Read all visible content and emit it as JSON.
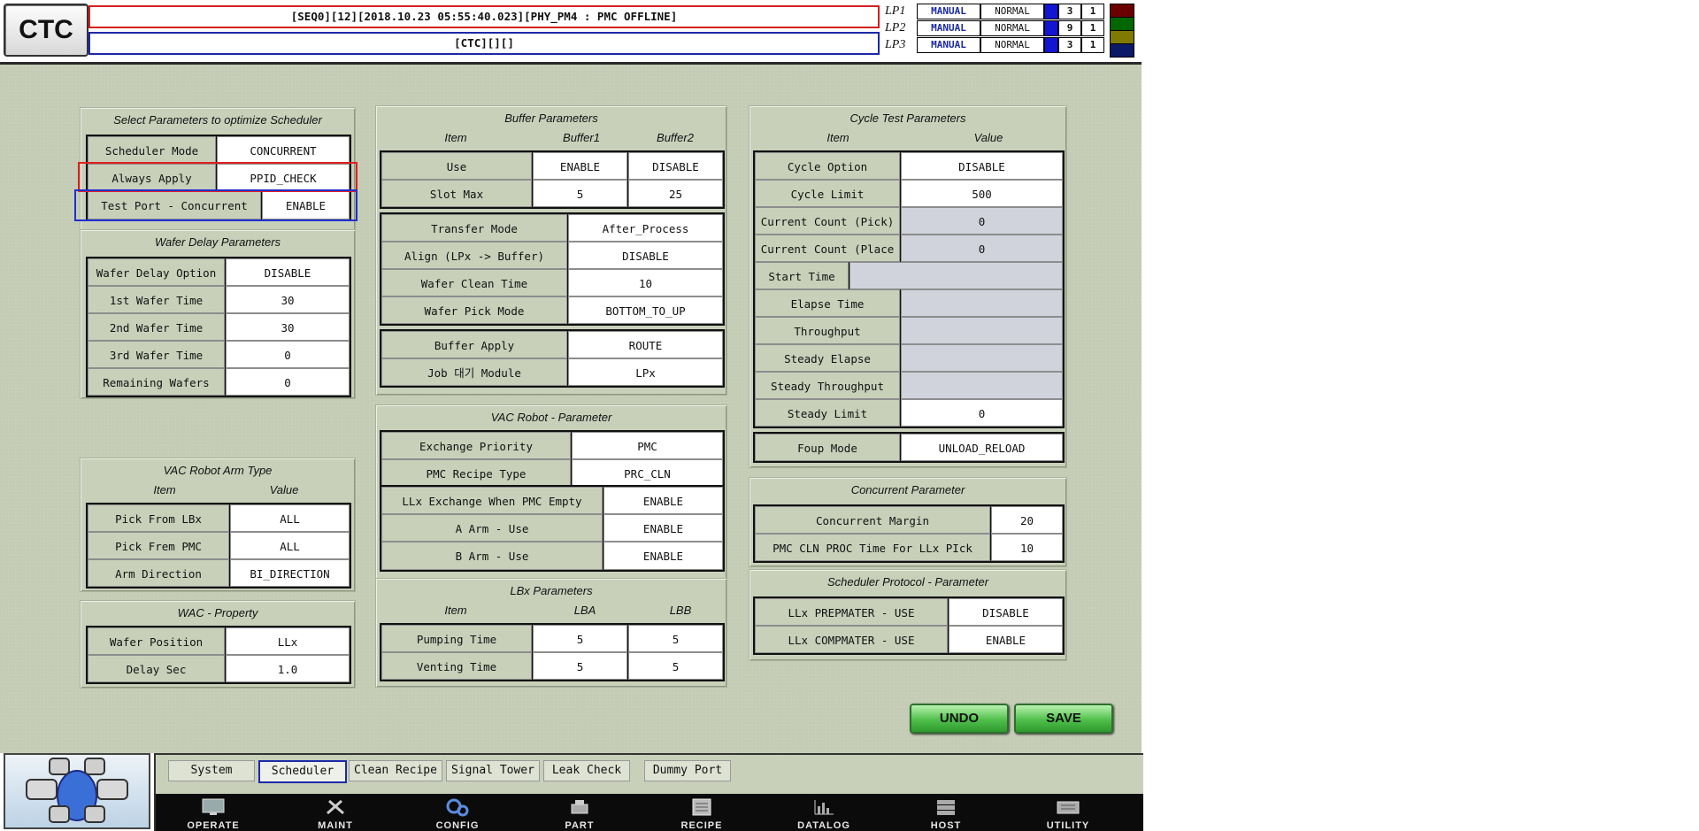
{
  "header": {
    "logo": "CTC",
    "message_top": "[SEQ0][12][2018.10.23 05:55:40.023][PHY_PM4 : PMC OFFLINE]",
    "message_bottom": "[CTC][][]",
    "load_ports": [
      {
        "name": "LP1",
        "mode": "MANUAL",
        "state": "NORMAL",
        "n1": "3",
        "n2": "1",
        "swatch": "#6b0000"
      },
      {
        "name": "LP2",
        "mode": "MANUAL",
        "state": "NORMAL",
        "n1": "9",
        "n2": "1",
        "swatch": "#006600"
      },
      {
        "name": "LP3",
        "mode": "MANUAL",
        "state": "NORMAL",
        "n1": "3",
        "n2": "1",
        "swatch": "#7f7a00"
      }
    ],
    "extra_swatch": "#0a1a66"
  },
  "scheduler": {
    "title": "Select Parameters to optimize Scheduler",
    "rows": [
      {
        "label": "Scheduler Mode",
        "value": "CONCURRENT"
      },
      {
        "label": "Always Apply",
        "value": "PPID_CHECK"
      },
      {
        "label": "Test Port - Concurrent",
        "value": "ENABLE"
      }
    ]
  },
  "wafer_delay": {
    "title": "Wafer Delay Parameters",
    "rows": [
      {
        "label": "Wafer Delay Option",
        "value": "DISABLE"
      },
      {
        "label": "1st Wafer Time",
        "value": "30"
      },
      {
        "label": "2nd Wafer Time",
        "value": "30"
      },
      {
        "label": "3rd Wafer Time",
        "value": "0"
      },
      {
        "label": "Remaining Wafers",
        "value": "0"
      }
    ]
  },
  "vac_arm": {
    "title": "VAC Robot Arm Type",
    "col1": "Item",
    "col2": "Value",
    "rows": [
      {
        "label": "Pick From LBx",
        "value": "ALL"
      },
      {
        "label": "Pick Frem PMC",
        "value": "ALL"
      },
      {
        "label": "Arm Direction",
        "value": "BI_DIRECTION"
      }
    ]
  },
  "wac": {
    "title": "WAC - Property",
    "rows": [
      {
        "label": "Wafer Position",
        "value": "LLx"
      },
      {
        "label": "Delay Sec",
        "value": "1.0"
      }
    ]
  },
  "buffer": {
    "title": "Buffer Parameters",
    "col1": "Item",
    "col2": "Buffer1",
    "col3": "Buffer2",
    "rows": [
      {
        "label": "Use",
        "v1": "ENABLE",
        "v2": "DISABLE"
      },
      {
        "label": "Slot Max",
        "v1": "5",
        "v2": "25"
      }
    ],
    "rows2": [
      {
        "label": "Transfer Mode",
        "value": "After_Process"
      },
      {
        "label": "Align (LPx -> Buffer)",
        "value": "DISABLE"
      },
      {
        "label": "Wafer Clean Time",
        "value": "10"
      },
      {
        "label": "Wafer Pick Mode",
        "value": "BOTTOM_TO_UP"
      }
    ],
    "rows3": [
      {
        "label": "Buffer Apply",
        "value": "ROUTE"
      },
      {
        "label": "Job 대기 Module",
        "value": "LPx"
      }
    ]
  },
  "vac_robot": {
    "title": "VAC Robot - Parameter",
    "rows": [
      {
        "label": "Exchange Priority",
        "value": "PMC"
      },
      {
        "label": "PMC Recipe Type",
        "value": "PRC_CLN"
      }
    ],
    "rows2": [
      {
        "label": "LLx Exchange When PMC Empty",
        "value": "ENABLE"
      },
      {
        "label": "A Arm - Use",
        "value": "ENABLE"
      },
      {
        "label": "B Arm - Use",
        "value": "ENABLE"
      }
    ]
  },
  "lbx": {
    "title": "LBx Parameters",
    "col1": "Item",
    "col2": "LBA",
    "col3": "LBB",
    "rows": [
      {
        "label": "Pumping Time",
        "v1": "5",
        "v2": "5"
      },
      {
        "label": "Venting Time",
        "v1": "5",
        "v2": "5"
      }
    ]
  },
  "cycle": {
    "title": "Cycle Test Parameters",
    "col1": "Item",
    "col2": "Value",
    "rows": [
      {
        "label": "Cycle Option",
        "value": "DISABLE"
      },
      {
        "label": "Cycle Limit",
        "value": "500"
      },
      {
        "label": "Current Count (Pick)",
        "value": "0"
      },
      {
        "label": "Current Count (Place",
        "value": "0"
      },
      {
        "label": "Start Time",
        "value": ""
      },
      {
        "label": "Elapse Time",
        "value": ""
      },
      {
        "label": "Throughput",
        "value": ""
      },
      {
        "label": "Steady Elapse",
        "value": ""
      },
      {
        "label": "Steady Throughput",
        "value": ""
      },
      {
        "label": "Steady Limit",
        "value": "0"
      }
    ],
    "foup_label": "Foup Mode",
    "foup_value": "UNLOAD_RELOAD"
  },
  "concurrent": {
    "title": "Concurrent Parameter",
    "rows": [
      {
        "label": "Concurrent Margin",
        "value": "20"
      },
      {
        "label": "PMC CLN PROC Time For LLx PIck",
        "value": "10"
      }
    ]
  },
  "protocol": {
    "title": "Scheduler Protocol - Parameter",
    "rows": [
      {
        "label": "LLx PREPMATER - USE",
        "value": "DISABLE"
      },
      {
        "label": "LLx COMPMATER - USE",
        "value": "ENABLE"
      }
    ]
  },
  "actions": {
    "undo": "UNDO",
    "save": "SAVE"
  },
  "tabs": [
    "System",
    "Scheduler",
    "Clean Recipe",
    "Signal Tower",
    "Leak Check",
    "Dummy Port"
  ],
  "active_tab": "Scheduler",
  "nav": [
    {
      "label": "OPERATE",
      "icon": "monitor-icon"
    },
    {
      "label": "MAINT",
      "icon": "tools-icon"
    },
    {
      "label": "CONFIG",
      "icon": "gears-icon"
    },
    {
      "label": "PART",
      "icon": "part-icon"
    },
    {
      "label": "RECIPE",
      "icon": "recipe-icon"
    },
    {
      "label": "DATALOG",
      "icon": "chart-icon"
    },
    {
      "label": "HOST",
      "icon": "server-icon"
    },
    {
      "label": "UTILITY",
      "icon": "utility-icon"
    }
  ]
}
